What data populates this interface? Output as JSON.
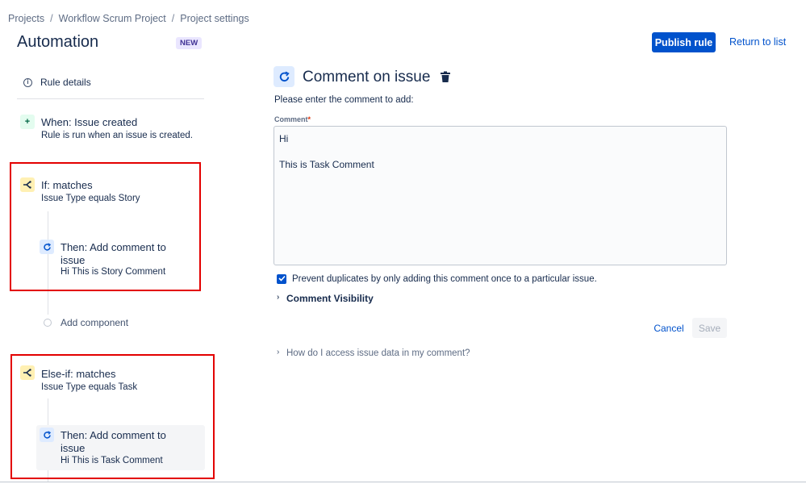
{
  "breadcrumb": {
    "items": [
      "Projects",
      "Workflow Scrum Project",
      "Project settings"
    ],
    "separator": "/"
  },
  "header": {
    "title": "Automation",
    "badge": "NEW",
    "publish_label": "Publish rule",
    "return_label": "Return to list"
  },
  "sidebar": {
    "rule_details": "Rule details",
    "trigger": {
      "title": "When: Issue created",
      "subtitle": "Rule is run when an issue is created."
    },
    "if_block": {
      "title": "If: matches",
      "subtitle": "Issue Type equals Story",
      "action_title": "Then: Add comment to issue",
      "action_subtitle": "Hi This is Story Comment"
    },
    "add_component": "Add component",
    "else_if_block": {
      "title": "Else-if: matches",
      "subtitle": "Issue Type equals Task",
      "action_title": "Then: Add comment to issue",
      "action_subtitle": "Hi This is Task Comment"
    }
  },
  "main": {
    "title": "Comment on issue",
    "instruction": "Please enter the comment to add:",
    "field_label": "Comment",
    "required_mark": "*",
    "comment_value": "Hi\n\nThis is Task Comment",
    "prevent_duplicates_label": "Prevent duplicates by only adding this comment once to a particular issue.",
    "prevent_duplicates_checked": true,
    "visibility_label": "Comment Visibility",
    "cancel_label": "Cancel",
    "save_label": "Save",
    "help_label": "How do I access issue data in my comment?"
  },
  "colors": {
    "primary": "#0052cc",
    "highlight": "#e30000",
    "badge_bg": "#eae6ff",
    "trigger_tile": "#e3fcef",
    "condition_tile": "#fff0b3",
    "action_tile": "#deebff"
  },
  "icons": [
    "info-icon",
    "plus-icon",
    "branch-icon",
    "refresh-comment-icon",
    "trash-icon",
    "checkmark-icon",
    "chevron-right-icon"
  ]
}
